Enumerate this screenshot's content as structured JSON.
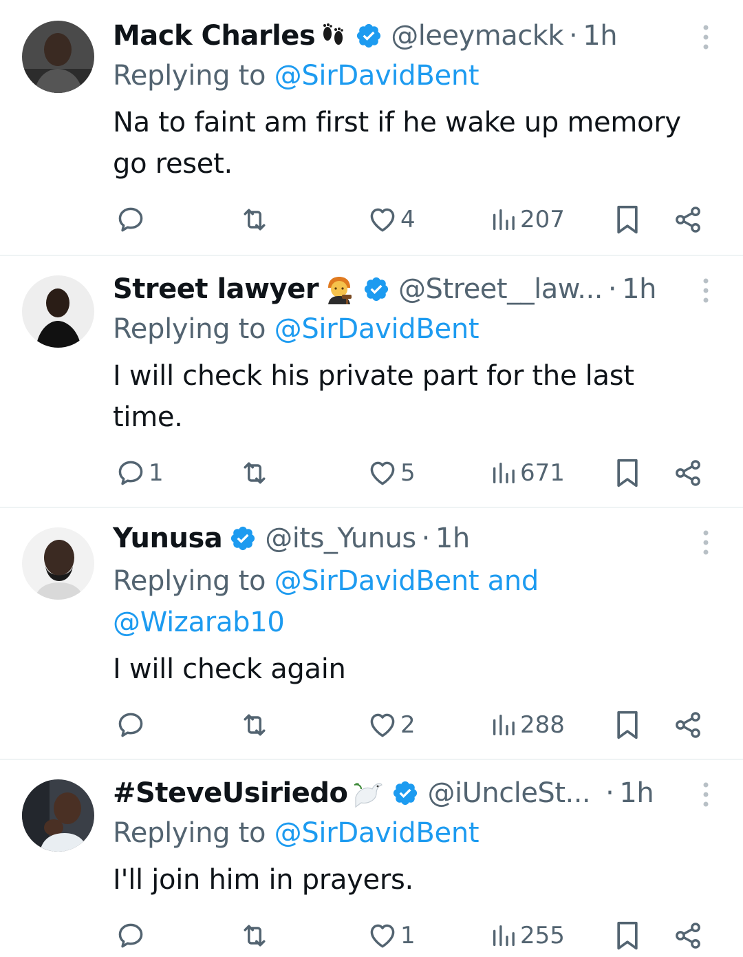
{
  "tweets": [
    {
      "name": "Mack Charles",
      "name_emoji": "footprints-emoji",
      "handle": "@leeymackk",
      "time": "1h",
      "replying_prefix": "Replying to ",
      "replying_to_line1": "@SirDavidBent",
      "replying_to_line2": "",
      "text": "Na to faint am first if he wake up memory go reset.",
      "replies": "",
      "retweets": "",
      "likes": "4",
      "views": "207"
    },
    {
      "name": "Street lawyer",
      "name_emoji": "judge-emoji",
      "handle": "@Street__law...",
      "time": "1h",
      "replying_prefix": "Replying to ",
      "replying_to_line1": "@SirDavidBent",
      "replying_to_line2": "",
      "text": "I will check his private part for the last time.",
      "replies": "1",
      "retweets": "",
      "likes": "5",
      "views": "671"
    },
    {
      "name": "Yunusa",
      "name_emoji": "",
      "handle": "@its_Yunus",
      "time": "1h",
      "replying_prefix": "Replying to ",
      "replying_to_line1": "@SirDavidBent and",
      "replying_to_line2": "@Wizarab10",
      "text": "I will check again",
      "replies": "",
      "retweets": "",
      "likes": "2",
      "views": "288"
    },
    {
      "name": "#SteveUsiriedo",
      "name_emoji": "dove-emoji",
      "handle": "@iUncleSt...",
      "time": "1h",
      "replying_prefix": "Replying to ",
      "replying_to_line1": "@SirDavidBent",
      "replying_to_line2": "",
      "text": "I'll join him in prayers.",
      "replies": "",
      "retweets": "",
      "likes": "1",
      "views": "255"
    }
  ],
  "colors": {
    "text": "#0f1419",
    "muted": "#536471",
    "accent": "#1d9bf0",
    "divider": "#eff3f4"
  },
  "time_separator": "·"
}
